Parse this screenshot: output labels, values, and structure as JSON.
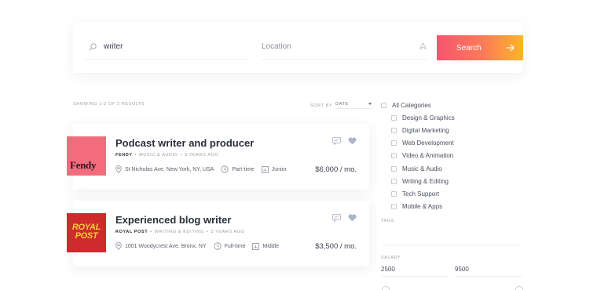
{
  "search": {
    "keyword_value": "writer",
    "location_placeholder": "Location",
    "button_label": "Search"
  },
  "results": {
    "count_label": "SHOWING 1-2 OF 2 RESULTS",
    "sort_label": "SORT BY",
    "sort_value": "DATE"
  },
  "jobs": [
    {
      "title": "Podcast writer and producer",
      "company": "FENDY",
      "category": "MUSIC & AUDIO",
      "posted": "3 YEARS AGO",
      "location": "St Nicholas Ave, New York, NY, USA",
      "type": "Part-time",
      "level": "Junior",
      "salary": "$6,000 / mo.",
      "logo_text": "Fendy",
      "logo_color": "#f26c7d"
    },
    {
      "title": "Experienced blog writer",
      "company": "ROYAL POST",
      "category": "WRITING & EDITING",
      "posted": "3 YEARS AGO",
      "location": "1001 Woodycrest Ave, Bronx, NY",
      "type": "Full-time",
      "level": "Middle",
      "salary": "$3,500 / mo.",
      "logo_text": "ROYAL POST",
      "logo_color": "#cf2b2d"
    }
  ],
  "filters": {
    "all_categories": "All Categories",
    "categories": [
      "Design & Graphics",
      "Digital Marketing",
      "Web Development",
      "Video & Animation",
      "Music & Audio",
      "Writing & Editing",
      "Tech Support",
      "Mobile & Apps"
    ],
    "tags_label": "TAGS",
    "salary_label": "SALARY",
    "salary_min": "2500",
    "salary_max": "9500"
  },
  "colors": {
    "accent_start": "#f7546f",
    "accent_end": "#fdb528",
    "heart": "#aab4c8"
  },
  "icons": {
    "search": "search-icon",
    "location": "location-arrow-icon",
    "arrow": "arrow-right-icon",
    "chat": "chat-icon",
    "heart": "heart-icon",
    "pin": "map-pin-icon",
    "clock": "clock-icon",
    "level": "level-chart-icon"
  }
}
